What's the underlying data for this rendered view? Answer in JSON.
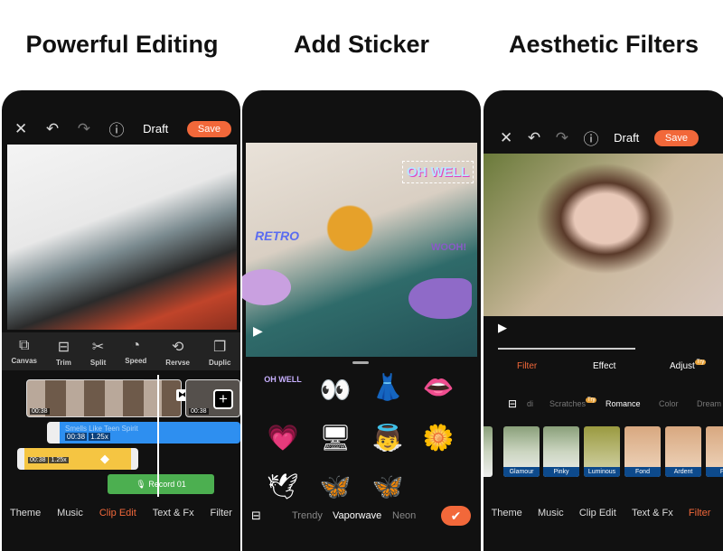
{
  "headings": [
    "Powerful Editing",
    "Add Sticker",
    "Aesthetic Filters"
  ],
  "editor": {
    "draft": "Draft",
    "save": "Save",
    "tools": [
      {
        "icon": "canvas-icon",
        "label": "Canvas"
      },
      {
        "icon": "trim-icon",
        "label": "Trim"
      },
      {
        "icon": "scissors-icon",
        "label": "Split"
      },
      {
        "icon": "speed-icon",
        "label": "Speed"
      },
      {
        "icon": "reverse-icon",
        "label": "Rervse"
      },
      {
        "icon": "duplicate-icon",
        "label": "Duplic"
      }
    ],
    "clip_time_1": "00:38",
    "clip_time_2": "00:38",
    "music_track": "Smells Like Teen Spirit",
    "music_time": "00:38",
    "music_speed": "1.25x",
    "sticker_time": "00:38",
    "sticker_speed": "1.25x",
    "record": "Record 01",
    "nav": [
      "Theme",
      "Music",
      "Clip Edit",
      "Text & Fx",
      "Filter"
    ],
    "nav_active": "Clip Edit"
  },
  "sticker": {
    "texts": [
      "OH WELL",
      "RETRO",
      "WOOH!"
    ],
    "categories": [
      "Trendy",
      "Vaporwave",
      "Neon"
    ],
    "active_category": "Vaporwave"
  },
  "filters": {
    "draft": "Draft",
    "save": "Save",
    "tabs": [
      "Filter",
      "Effect",
      "Adjust"
    ],
    "adjust_badge": "Try",
    "active_tab": "Filter",
    "categories": [
      "di",
      "Scratches",
      "Romance",
      "Color",
      "Dream"
    ],
    "scratches_badge": "Try",
    "active_category": "Romance",
    "items": [
      "Glamour",
      "Pinky",
      "Luminous",
      "Fond",
      "Ardent",
      "Fe"
    ],
    "nav": [
      "Theme",
      "Music",
      "Clip Edit",
      "Text & Fx",
      "Filter"
    ],
    "nav_active": "Filter"
  },
  "colors": {
    "accent": "#f2683a",
    "music": "#2e8ff0",
    "sticker_track": "#f5c542",
    "record": "#4caf50",
    "filter_label": "#0d4a8c"
  }
}
